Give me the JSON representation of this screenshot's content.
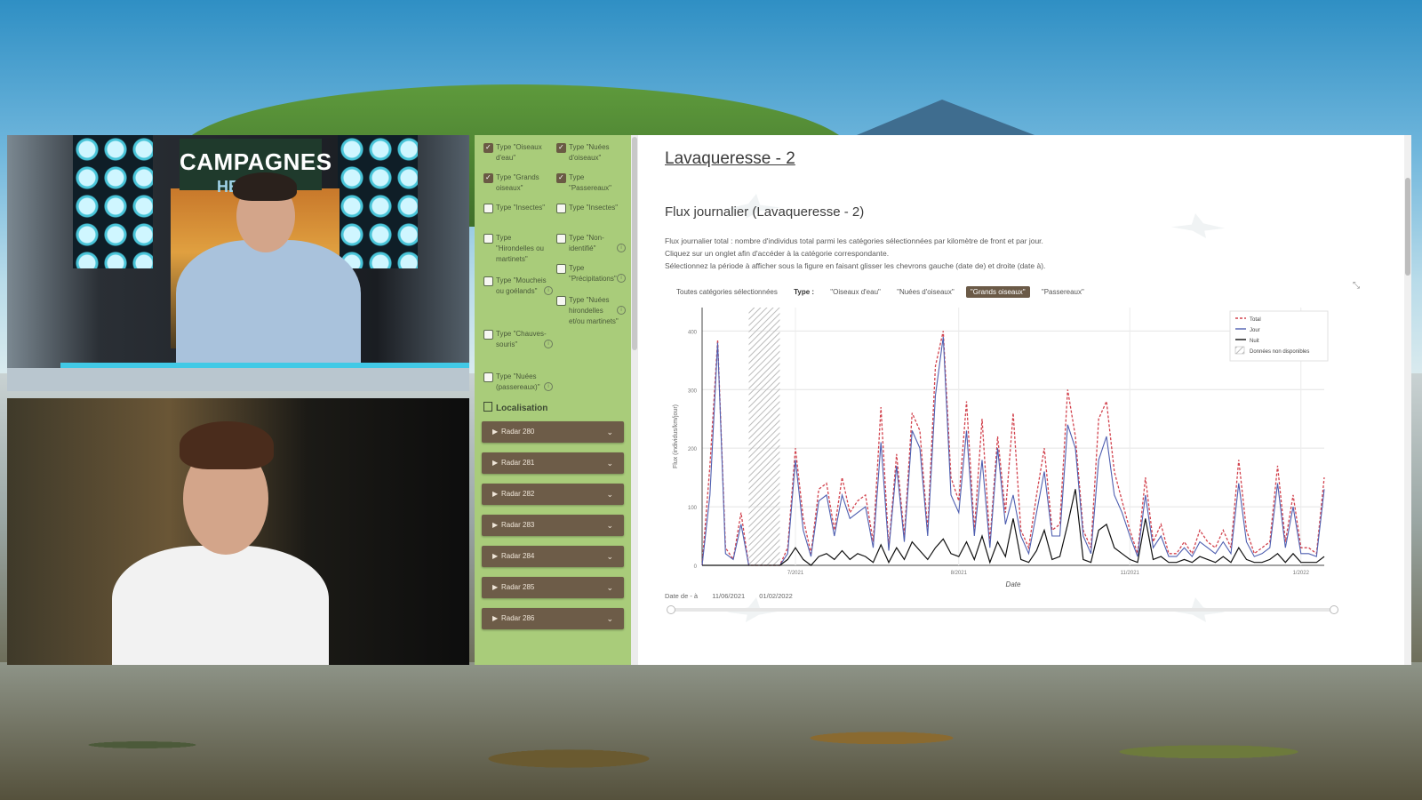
{
  "broadcast": {
    "logo_title": "CAMPAGNES",
    "logo_sub": "HEB"
  },
  "sidebar": {
    "filters": [
      {
        "label": "Type \"Oiseaux d'eau\"",
        "checked": true
      },
      {
        "label": "Type \"Nuées d'oiseaux\"",
        "checked": true
      },
      {
        "label": "Type \"Grands oiseaux\"",
        "checked": true
      },
      {
        "label": "Type \"Passereaux\"",
        "checked": true
      },
      {
        "label": "Type \"Insectes\"",
        "checked": false
      },
      {
        "label": "Type \"Insectes\"",
        "checked": false
      },
      {
        "label": "Type \"Hirondelles ou martinets\"",
        "checked": false
      },
      {
        "label": "Type \"Non-identifié\"",
        "checked": false
      },
      {
        "label": "Type \"Précipitations\"",
        "checked": false
      },
      {
        "label": "Type \"Moucheis ou goélands\"",
        "checked": false
      },
      {
        "label": "Type \"Nuées hirondelles et/ou martinets\"",
        "checked": false
      },
      {
        "label": "Type \"Chauves-souris\"",
        "checked": false
      },
      {
        "label": "Type \"Nuées (passereaux)\"",
        "checked": false
      }
    ],
    "localisation_label": "Localisation",
    "radars": [
      "Radar 280",
      "Radar 281",
      "Radar 282",
      "Radar 283",
      "Radar 284",
      "Radar 285",
      "Radar 286"
    ]
  },
  "main": {
    "page_title": "Lavaqueresse - 2",
    "section_title": "Flux journalier (Lavaqueresse - 2)",
    "desc_lines": [
      "Flux journalier total : nombre d'individus total parmi les catégories sélectionnées par kilomètre de front et par jour.",
      "Cliquez sur un onglet afin d'accéder à la catégorie correspondante.",
      "Sélectionnez la période à afficher sous la figure en faisant glisser les chevrons gauche (date de) et droite (date à)."
    ],
    "tabs": [
      {
        "label": "Toutes catégories sélectionnées",
        "style": "plain"
      },
      {
        "label": "Type :",
        "style": "bold"
      },
      {
        "label": "\"Oiseaux d'eau\"",
        "style": "plain"
      },
      {
        "label": "\"Nuées d'oiseaux\"",
        "style": "plain"
      },
      {
        "label": "\"Grands oiseaux\"",
        "style": "active"
      },
      {
        "label": "\"Passereaux\"",
        "style": "plain"
      }
    ],
    "date_range": {
      "label": "Date de - à",
      "from": "11/06/2021",
      "to": "01/02/2022"
    }
  },
  "colors": {
    "sidebar_bg": "#a9cc7a",
    "radar_btn": "#6d5c48",
    "total_line": "#d2434e",
    "day_line": "#4f5fb0",
    "night_line": "#111111"
  },
  "chart_data": {
    "type": "line",
    "xlabel": "Date",
    "ylabel": "Flux (individus/km/jour)",
    "x_tick_labels": [
      "7/2021",
      "8/2021",
      "11/2021",
      "1/2022"
    ],
    "y_tick_labels": [
      "0",
      "100",
      "200",
      "300",
      "400"
    ],
    "ylim": [
      0,
      440
    ],
    "grid": true,
    "legend_position": "top-right",
    "legend": [
      "Total",
      "Jour",
      "Nuit",
      "Données non disponibles"
    ],
    "unavailable_range_index": [
      6,
      10
    ],
    "series": [
      {
        "name": "Total",
        "style": "dashed",
        "values": [
          0,
          170,
          385,
          30,
          10,
          90,
          0,
          0,
          0,
          0,
          0,
          30,
          200,
          80,
          20,
          130,
          140,
          60,
          150,
          90,
          110,
          120,
          40,
          270,
          30,
          190,
          50,
          260,
          230,
          60,
          340,
          400,
          150,
          110,
          280,
          60,
          250,
          40,
          220,
          90,
          260,
          60,
          30,
          120,
          200,
          60,
          70,
          300,
          220,
          60,
          30,
          250,
          280,
          160,
          110,
          60,
          20,
          150,
          40,
          70,
          20,
          20,
          40,
          20,
          60,
          40,
          30,
          60,
          30,
          180,
          60,
          20,
          30,
          40,
          170,
          40,
          120,
          30,
          30,
          20,
          150
        ]
      },
      {
        "name": "Jour",
        "style": "solid",
        "values": [
          0,
          120,
          380,
          20,
          10,
          70,
          0,
          0,
          0,
          0,
          0,
          20,
          180,
          60,
          15,
          110,
          120,
          50,
          120,
          80,
          90,
          100,
          30,
          210,
          25,
          170,
          40,
          230,
          200,
          50,
          290,
          390,
          120,
          90,
          230,
          50,
          180,
          30,
          200,
          70,
          120,
          50,
          20,
          90,
          160,
          50,
          50,
          240,
          200,
          50,
          20,
          180,
          220,
          120,
          90,
          50,
          15,
          120,
          30,
          50,
          15,
          15,
          30,
          15,
          40,
          30,
          20,
          40,
          20,
          140,
          40,
          15,
          20,
          30,
          140,
          30,
          100,
          20,
          20,
          15,
          130
        ]
      },
      {
        "name": "Nuit",
        "style": "solid",
        "values": [
          0,
          0,
          0,
          0,
          0,
          0,
          0,
          0,
          0,
          0,
          0,
          10,
          30,
          10,
          0,
          15,
          20,
          10,
          25,
          10,
          20,
          15,
          5,
          35,
          5,
          30,
          10,
          40,
          25,
          10,
          30,
          45,
          20,
          15,
          40,
          10,
          50,
          5,
          40,
          15,
          80,
          10,
          5,
          25,
          60,
          10,
          15,
          70,
          130,
          10,
          5,
          60,
          70,
          30,
          20,
          10,
          5,
          80,
          10,
          15,
          5,
          5,
          10,
          5,
          15,
          10,
          5,
          15,
          5,
          30,
          10,
          5,
          5,
          10,
          20,
          5,
          20,
          5,
          5,
          5,
          15
        ]
      }
    ]
  }
}
